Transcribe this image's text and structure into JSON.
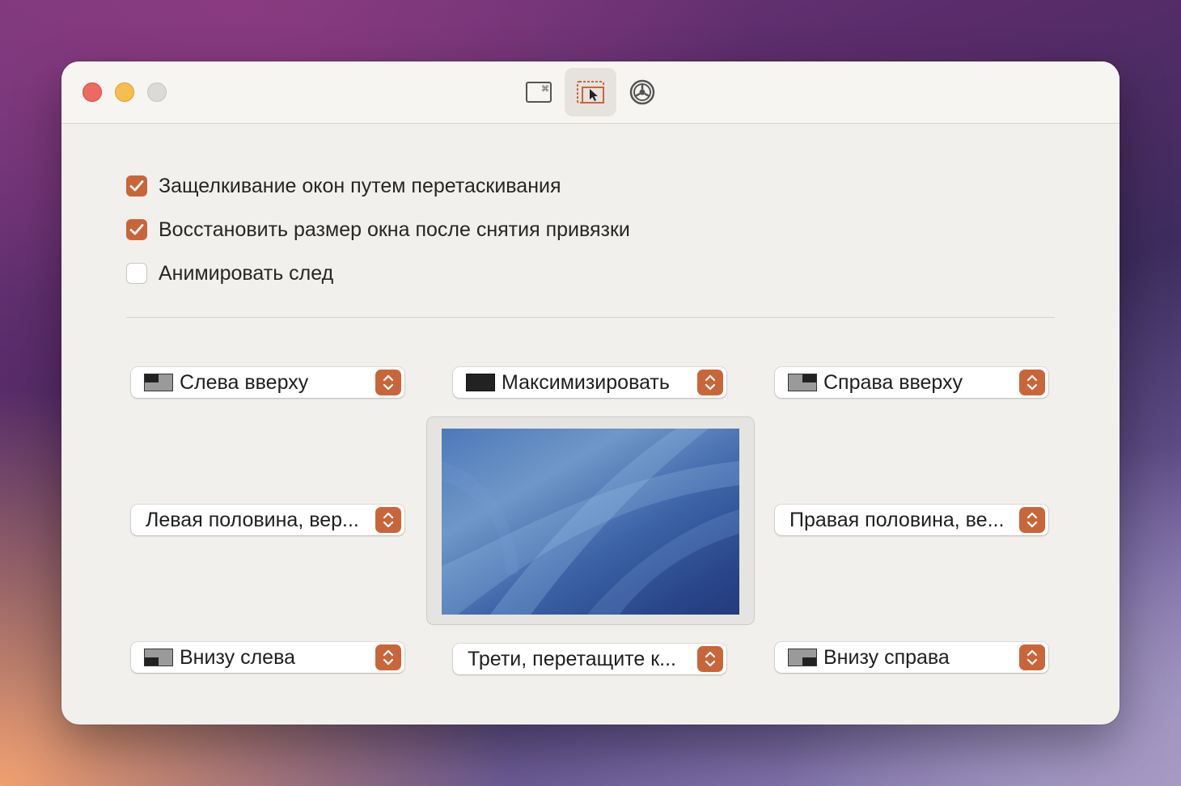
{
  "toolbar": {
    "tabs": [
      {
        "icon": "keyboard-shortcut-icon"
      },
      {
        "icon": "snap-drag-icon",
        "active": true
      },
      {
        "icon": "gear-icon"
      }
    ]
  },
  "settings": {
    "options": [
      {
        "label": "Защелкивание окон путем перетаскивания",
        "checked": true
      },
      {
        "label": "Восстановить размер окна после снятия привязки",
        "checked": true
      },
      {
        "label": "Анимировать след",
        "checked": false
      }
    ]
  },
  "snap_areas": {
    "top_left": "Слева вверху",
    "top_center": "Максимизировать",
    "top_right": "Справа вверху",
    "middle_left": "Левая половина, вер...",
    "middle_right": "Правая половина, ве...",
    "bottom_left": "Внизу слева",
    "bottom_center": "Трети, перетащите к...",
    "bottom_right": "Внизу справа"
  },
  "colors": {
    "accent": "#c8663a",
    "window_bg": "#f2f0ed"
  }
}
